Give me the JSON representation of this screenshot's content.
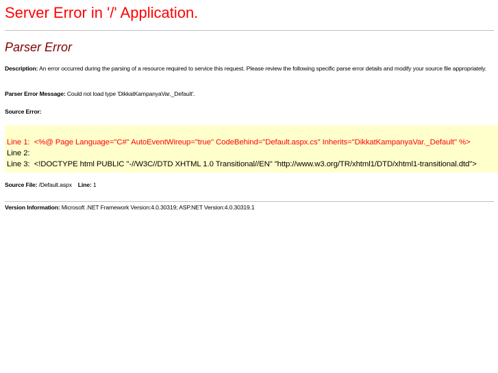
{
  "title": "Server Error in '/' Application.",
  "subtitle": "Parser Error",
  "description": {
    "label": "Description:",
    "text": " An error occurred during the parsing of a resource required to service this request. Please review the following specific parse error details and modify your source file appropriately."
  },
  "parser_message": {
    "label": "Parser Error Message:",
    "text": " Could not load type 'DikkatKampanyaVar._Default'."
  },
  "source_error_label": "Source Error:",
  "source_lines": [
    {
      "label": "Line 1:",
      "code": "<%@ Page Language=\"C#\" AutoEventWireup=\"true\" CodeBehind=\"Default.aspx.cs\" Inherits=\"DikkatKampanyaVar._Default\" %>"
    },
    {
      "label": "Line 2:",
      "code": ""
    },
    {
      "label": "Line 3:",
      "code": "<!DOCTYPE html PUBLIC \"-//W3C//DTD XHTML 1.0 Transitional//EN\" \"http://www.w3.org/TR/xhtml1/DTD/xhtml1-transitional.dtd\">"
    }
  ],
  "source_file": {
    "label": "Source File:",
    "value": " /Default.aspx",
    "line_label": "Line:",
    "line_value": " 1"
  },
  "version": {
    "label": "Version Information:",
    "text": " Microsoft .NET Framework Version:4.0.30319; ASP.NET Version:4.0.30319.1"
  },
  "colors": {
    "title": "#ff0000",
    "subtitle": "#800000",
    "code_bg": "#ffffcc",
    "error_line": "#ff0000"
  }
}
